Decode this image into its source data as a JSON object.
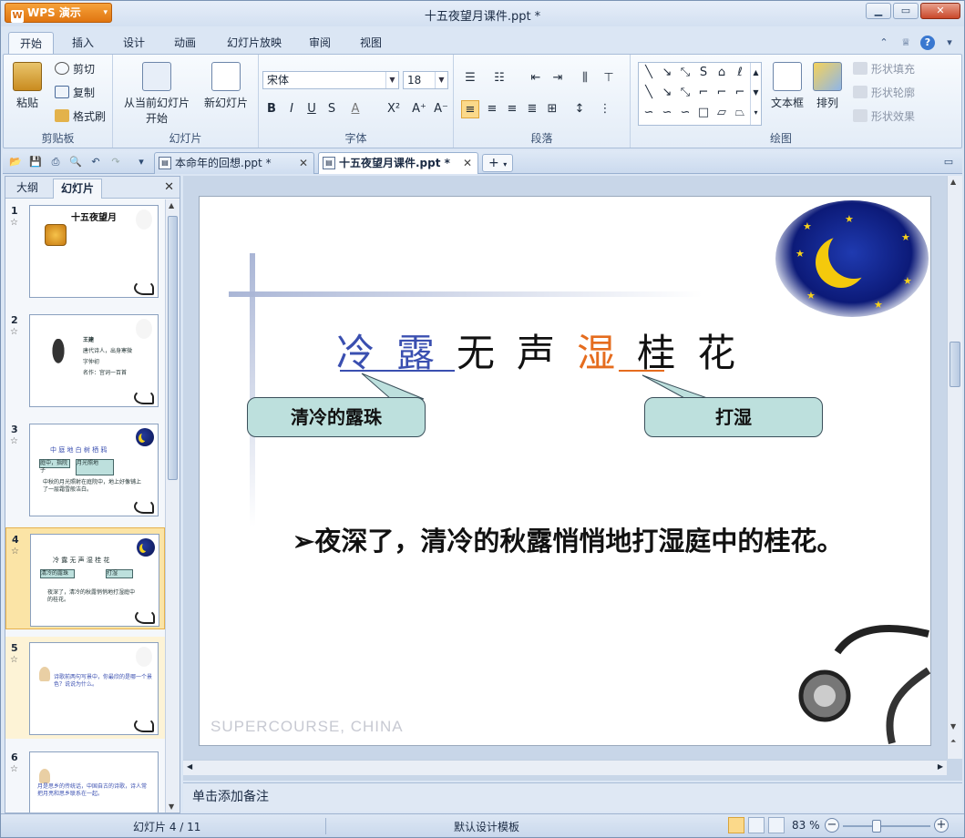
{
  "app": {
    "menu_button": "WPS 演示",
    "window_title": "十五夜望月课件.ppt *"
  },
  "ribbon_tabs": [
    "开始",
    "插入",
    "设计",
    "动画",
    "幻灯片放映",
    "审阅",
    "视图"
  ],
  "ribbon": {
    "clipboard": {
      "paste": "粘贴",
      "cut": "剪切",
      "copy": "复制",
      "format_painter": "格式刷",
      "group": "剪贴板"
    },
    "slides": {
      "from_current_line1": "从当前幻灯片",
      "from_current_line2": "开始",
      "new_slide": "新幻灯片",
      "group": "幻灯片"
    },
    "font": {
      "font_name": "宋体",
      "font_size": "18",
      "group": "字体"
    },
    "paragraph": {
      "group": "段落"
    },
    "drawing": {
      "textbox": "文本框",
      "arrange": "排列",
      "shape_fill": "形状填充",
      "shape_outline": "形状轮廓",
      "shape_effects": "形状效果",
      "group": "绘图"
    }
  },
  "doc_tabs": [
    {
      "label": "本命年的回想.ppt *",
      "active": false
    },
    {
      "label": "十五夜望月课件.ppt *",
      "active": true
    }
  ],
  "left_panel": {
    "tabs": [
      "大纲",
      "幻灯片"
    ],
    "slides": [
      {
        "num": "1",
        "title": "十五夜望月"
      },
      {
        "num": "2",
        "title": "王建",
        "lines": [
          "唐代诗人，出身寒微",
          "字仲初",
          "名作：宫词一百首"
        ]
      },
      {
        "num": "3",
        "title": "中 庭 地 白 树 栖 鸦",
        "lines": [
          "庭中，指院子",
          "月光照地",
          "中秋的月光照射在庭院中，地上好像铺上了一层霜雪般洁白。"
        ]
      },
      {
        "num": "4",
        "title": "冷 露 无 声 湿 桂 花",
        "lines": [
          "清冷的露珠",
          "打湿",
          "夜深了，清冷的秋露悄悄地打湿庭中的桂花。"
        ]
      },
      {
        "num": "5",
        "title": "诗歌前两句写景中，你最欣的是哪一个景色？说说为什么。"
      },
      {
        "num": "6",
        "title": "月是思乡的传统话，中国自古的诗歌，诗人常把月亮和思乡联系在一起。"
      }
    ]
  },
  "slide": {
    "poem_chars": [
      "冷",
      "露",
      "无",
      "声",
      "湿",
      "桂",
      "花"
    ],
    "callout_left": "清冷的露珠",
    "callout_right": "打湿",
    "body": "夜深了，清冷的秋露悄悄地打湿庭中的桂花。",
    "bullet": "➢",
    "watermark": "SUPERCOURSE, CHINA",
    "colors": {
      "highlight_blue": "#3a4fb0",
      "highlight_orange": "#e56c1e",
      "callout_fill": "#bde0dd"
    }
  },
  "notes_placeholder": "单击添加备注",
  "status": {
    "slide_counter": "幻灯片 4 / 11",
    "template": "默认设计模板",
    "zoom": "83 %"
  }
}
